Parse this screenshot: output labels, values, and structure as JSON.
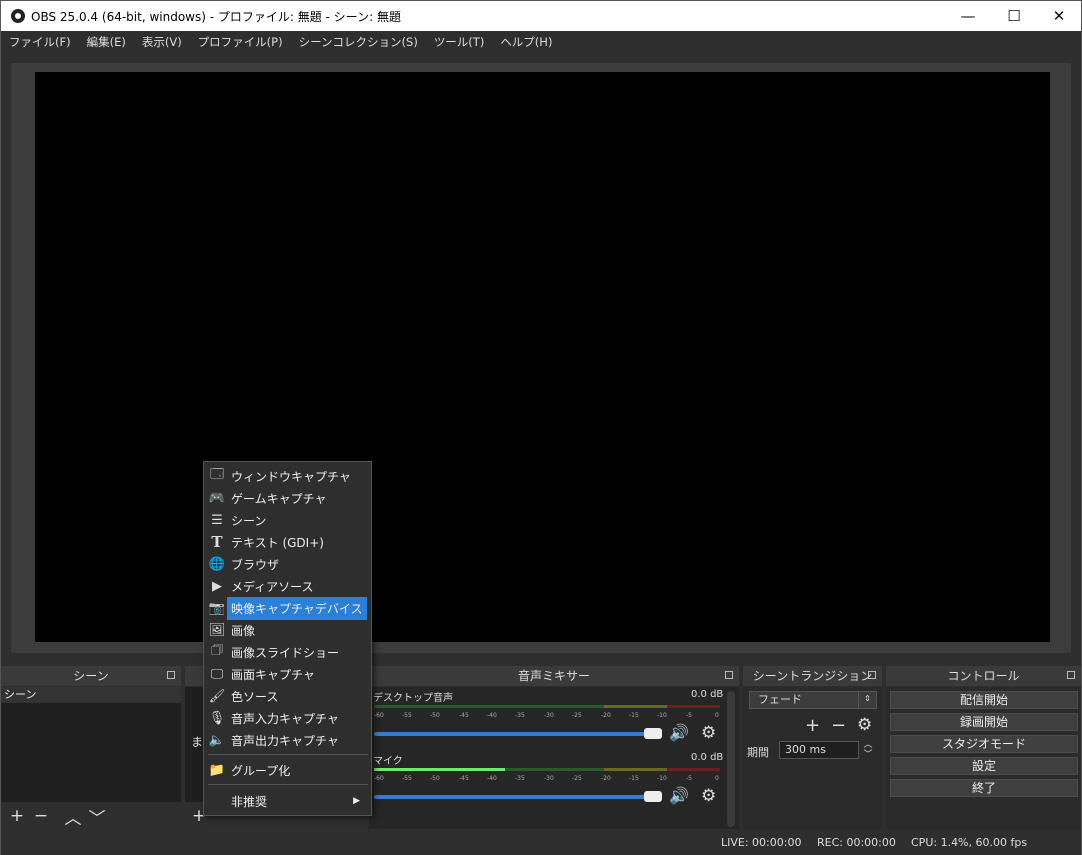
{
  "window": {
    "title": "OBS 25.0.4 (64-bit, windows) - プロファイル: 無題 - シーン: 無題",
    "minimize": "—",
    "maximize": "☐",
    "close": "✕"
  },
  "menubar": [
    "ファイル(F)",
    "編集(E)",
    "表示(V)",
    "プロファイル(P)",
    "シーンコレクション(S)",
    "ツール(T)",
    "ヘルプ(H)"
  ],
  "docks": {
    "scenes": {
      "title": "シーン",
      "items": [
        "シーン"
      ]
    },
    "sources": {
      "partial_text": "ま"
    },
    "mixer": {
      "title": "音声ミキサー",
      "channels": [
        {
          "name": "デスクトップ音声",
          "db": "0.0 dB",
          "level": 0.0
        },
        {
          "name": "マイク",
          "db": "0.0 dB",
          "level": 0.38
        }
      ],
      "scale": [
        "-60",
        "-55",
        "-50",
        "-45",
        "-40",
        "-35",
        "-30",
        "-25",
        "-20",
        "-15",
        "-10",
        "-5",
        "0"
      ]
    },
    "transitions": {
      "title": "シーントランジション",
      "type": "フェード",
      "duration_label": "期間",
      "duration_value": "300 ms"
    },
    "controls": {
      "title": "コントロール",
      "buttons": [
        "配信開始",
        "録画開始",
        "スタジオモード",
        "設定",
        "終了"
      ]
    }
  },
  "context_menu": {
    "items": [
      {
        "label": "ウィンドウキャプチャ",
        "icon": "window-icon"
      },
      {
        "label": "ゲームキャプチャ",
        "icon": "gamepad-icon"
      },
      {
        "label": "シーン",
        "icon": "list-icon"
      },
      {
        "label": "テキスト (GDI+)",
        "icon": "text-icon"
      },
      {
        "label": "ブラウザ",
        "icon": "globe-icon"
      },
      {
        "label": "メディアソース",
        "icon": "play-icon"
      },
      {
        "label": "映像キャプチャデバイス",
        "icon": "camera-icon",
        "selected": true
      },
      {
        "label": "画像",
        "icon": "image-icon"
      },
      {
        "label": "画像スライドショー",
        "icon": "slideshow-icon"
      },
      {
        "label": "画面キャプチャ",
        "icon": "monitor-icon"
      },
      {
        "label": "色ソース",
        "icon": "brush-icon"
      },
      {
        "label": "音声入力キャプチャ",
        "icon": "microphone-icon"
      },
      {
        "label": "音声出力キャプチャ",
        "icon": "speaker-icon"
      }
    ],
    "group": "グループ化",
    "deprecated": "非推奨",
    "submenu_arrow": "▶"
  },
  "status": {
    "live": "LIVE: 00:00:00",
    "rec": "REC: 00:00:00",
    "cpu": "CPU: 1.4%, 60.00 fps"
  },
  "colors": {
    "accent": "#2a7fd8",
    "background": "#2e2e2e"
  }
}
